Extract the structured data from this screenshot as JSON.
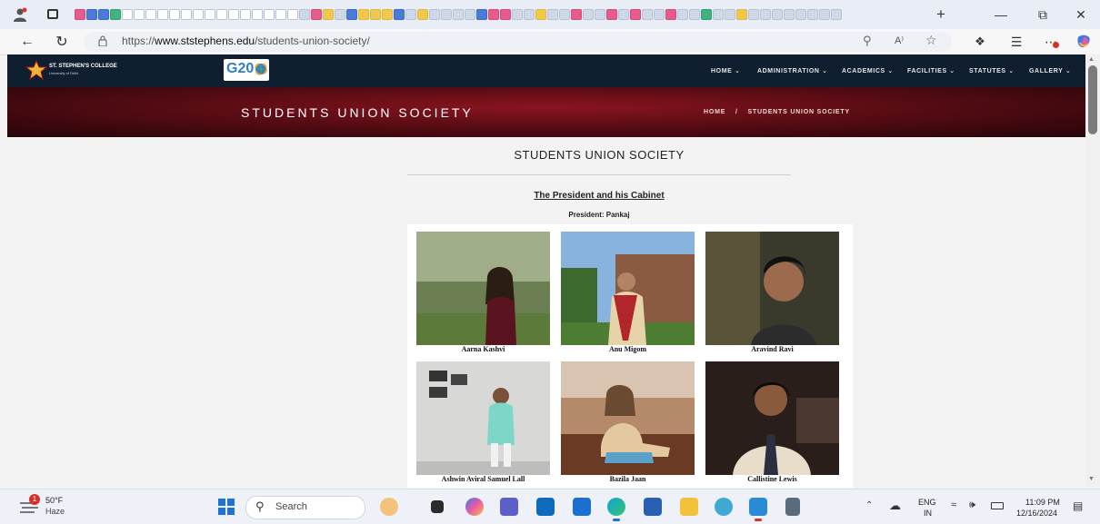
{
  "browser": {
    "url_prefix": "https://",
    "url_domain": "www.ststephens.edu",
    "url_path": "/students-union-society/",
    "new_tab_label": "+",
    "reader_label": "A⁾"
  },
  "site": {
    "college_name": "ST. STEPHEN'S COLLEGE",
    "college_sub": "University of Delhi",
    "g20_text": "G20",
    "nav": [
      "HOME",
      "ADMINISTRATION",
      "ACADEMICS",
      "FACILITIES",
      "STATUTES",
      "GALLERY"
    ],
    "banner_title": "STUDENTS UNION SOCIETY",
    "breadcrumb_home": "HOME",
    "breadcrumb_sep": "/",
    "breadcrumb_current": "STUDENTS UNION SOCIETY"
  },
  "content": {
    "heading": "STUDENTS UNION SOCIETY",
    "cabinet_title": "The President and his Cabinet",
    "president_line": "President: Pankaj",
    "members": [
      {
        "name": "Aarna Kashvi"
      },
      {
        "name": "Anu Migom"
      },
      {
        "name": "Aravind Ravi"
      },
      {
        "name": "Ashwin Aviral Samuel Lall"
      },
      {
        "name": "Bazila Jaan"
      },
      {
        "name": "Callistine Lewis"
      }
    ]
  },
  "taskbar": {
    "weather_temp": "50°F",
    "weather_desc": "Haze",
    "weather_badge": "1",
    "search_placeholder": "Search",
    "lang_top": "ENG",
    "lang_bottom": "IN",
    "time": "11:09 PM",
    "date": "12/16/2024"
  },
  "colors": {
    "header_bg": "#0f1f30",
    "banner_red": "#8a1420",
    "accent_gold": "#f0b43c"
  }
}
